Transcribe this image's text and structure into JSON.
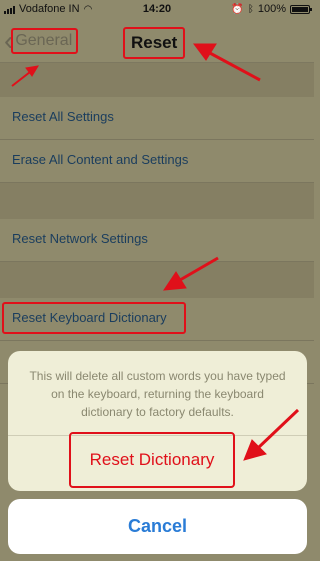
{
  "status_bar": {
    "carrier": "Vodafone IN",
    "time": "14:20",
    "battery": "100%"
  },
  "nav": {
    "back_label": "General",
    "title": "Reset"
  },
  "rows": [
    {
      "label": "Reset All Settings"
    },
    {
      "label": "Erase All Content and Settings"
    },
    {
      "label": "Reset Network Settings"
    },
    {
      "label": "Reset Keyboard Dictionary"
    }
  ],
  "sheet": {
    "message": "This will delete all custom words you have typed on the keyboard, returning the keyboard dictionary to factory defaults.",
    "action_label": "Reset Dictionary",
    "cancel_label": "Cancel"
  },
  "colors": {
    "annotation": "#e0101a",
    "link": "#1a3d5e",
    "cancel": "#2a7cd6"
  }
}
